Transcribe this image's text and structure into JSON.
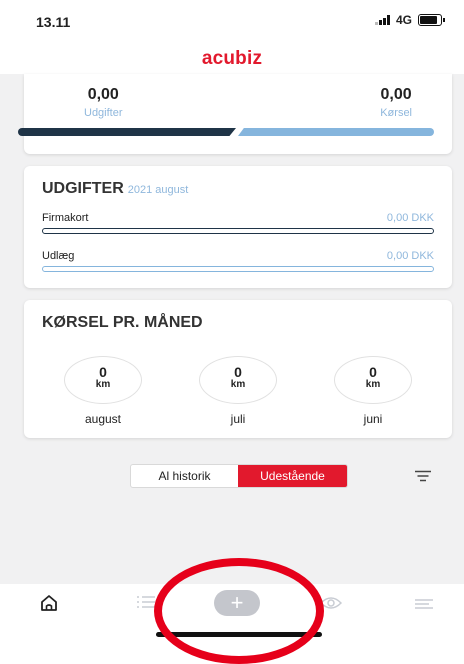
{
  "status_bar": {
    "time": "13.11",
    "network": "4G"
  },
  "header": {
    "brand": "acubiz",
    "brand_color": "#e2192d"
  },
  "totals": {
    "expenses_value": "0,00",
    "expenses_label": "Udgifter",
    "driving_value": "0,00",
    "driving_label": "Kørsel",
    "expenses_share": 0.5
  },
  "expenses": {
    "title": "UDGIFTER",
    "period": "2021 august",
    "rows": [
      {
        "label": "Firmakort",
        "value": "0,00 DKK"
      },
      {
        "label": "Udlæg",
        "value": "0,00 DKK"
      }
    ]
  },
  "driving": {
    "title": "KØRSEL PR. MÅNED",
    "months": [
      {
        "value": "0",
        "unit": "km",
        "month": "august"
      },
      {
        "value": "0",
        "unit": "km",
        "month": "juli"
      },
      {
        "value": "0",
        "unit": "km",
        "month": "juni"
      }
    ]
  },
  "filter": {
    "all_history": "Al historik",
    "outstanding": "Udestående",
    "selected": "Udestående"
  },
  "tabbar": {
    "add_symbol": "+",
    "icons": [
      "home-icon",
      "list-icon",
      "add-icon",
      "eye-icon",
      "menu-icon"
    ]
  },
  "colors": {
    "accent_red": "#e2192d",
    "dark_blue": "#1f3447",
    "light_blue": "#85b5dd",
    "annotation_ring": "#e6001a"
  }
}
